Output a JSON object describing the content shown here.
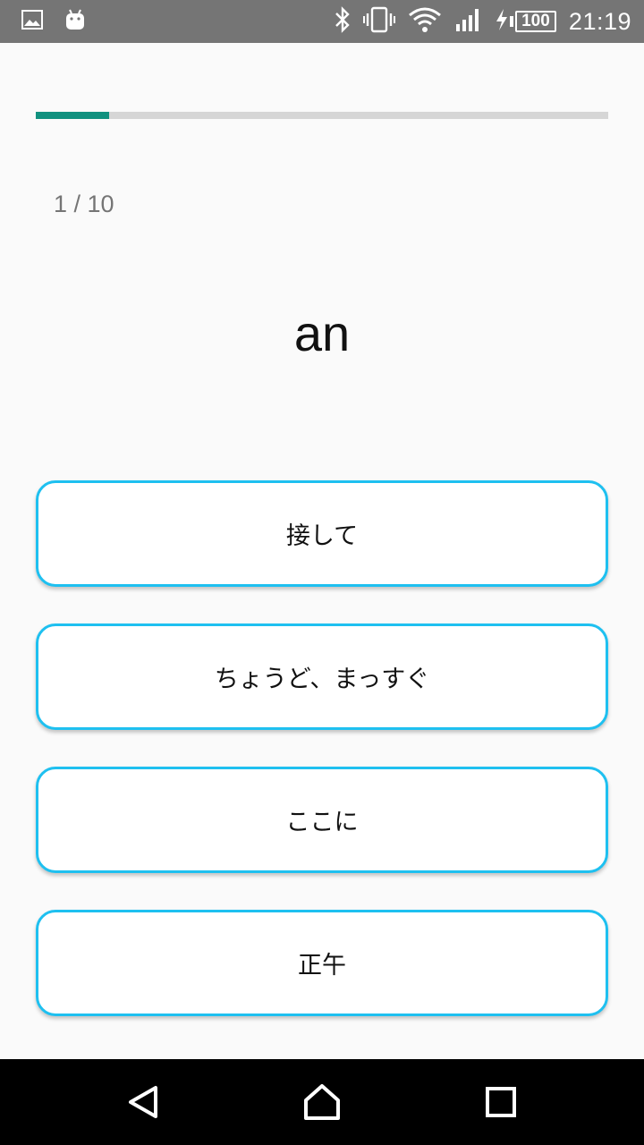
{
  "status_bar": {
    "time": "21:19",
    "battery_level": "100",
    "icons": [
      "gallery-icon",
      "android-icon",
      "bluetooth-icon",
      "vibrate-icon",
      "wifi-icon",
      "signal-icon",
      "charging-icon",
      "battery-icon"
    ]
  },
  "quiz": {
    "progress_fraction": 0.1,
    "counter": "1 / 10",
    "word": "an",
    "options": [
      "接して",
      "ちょうど、まっすぐ",
      "ここに",
      "正午"
    ]
  },
  "colors": {
    "progress_fill": "#12917f",
    "progress_track": "#d6d6d6",
    "option_border": "#1ec0f0",
    "status_bar": "#757575",
    "nav_bar": "#000000"
  },
  "nav_bar": {
    "buttons": [
      "back-icon",
      "home-icon",
      "recents-icon"
    ]
  }
}
